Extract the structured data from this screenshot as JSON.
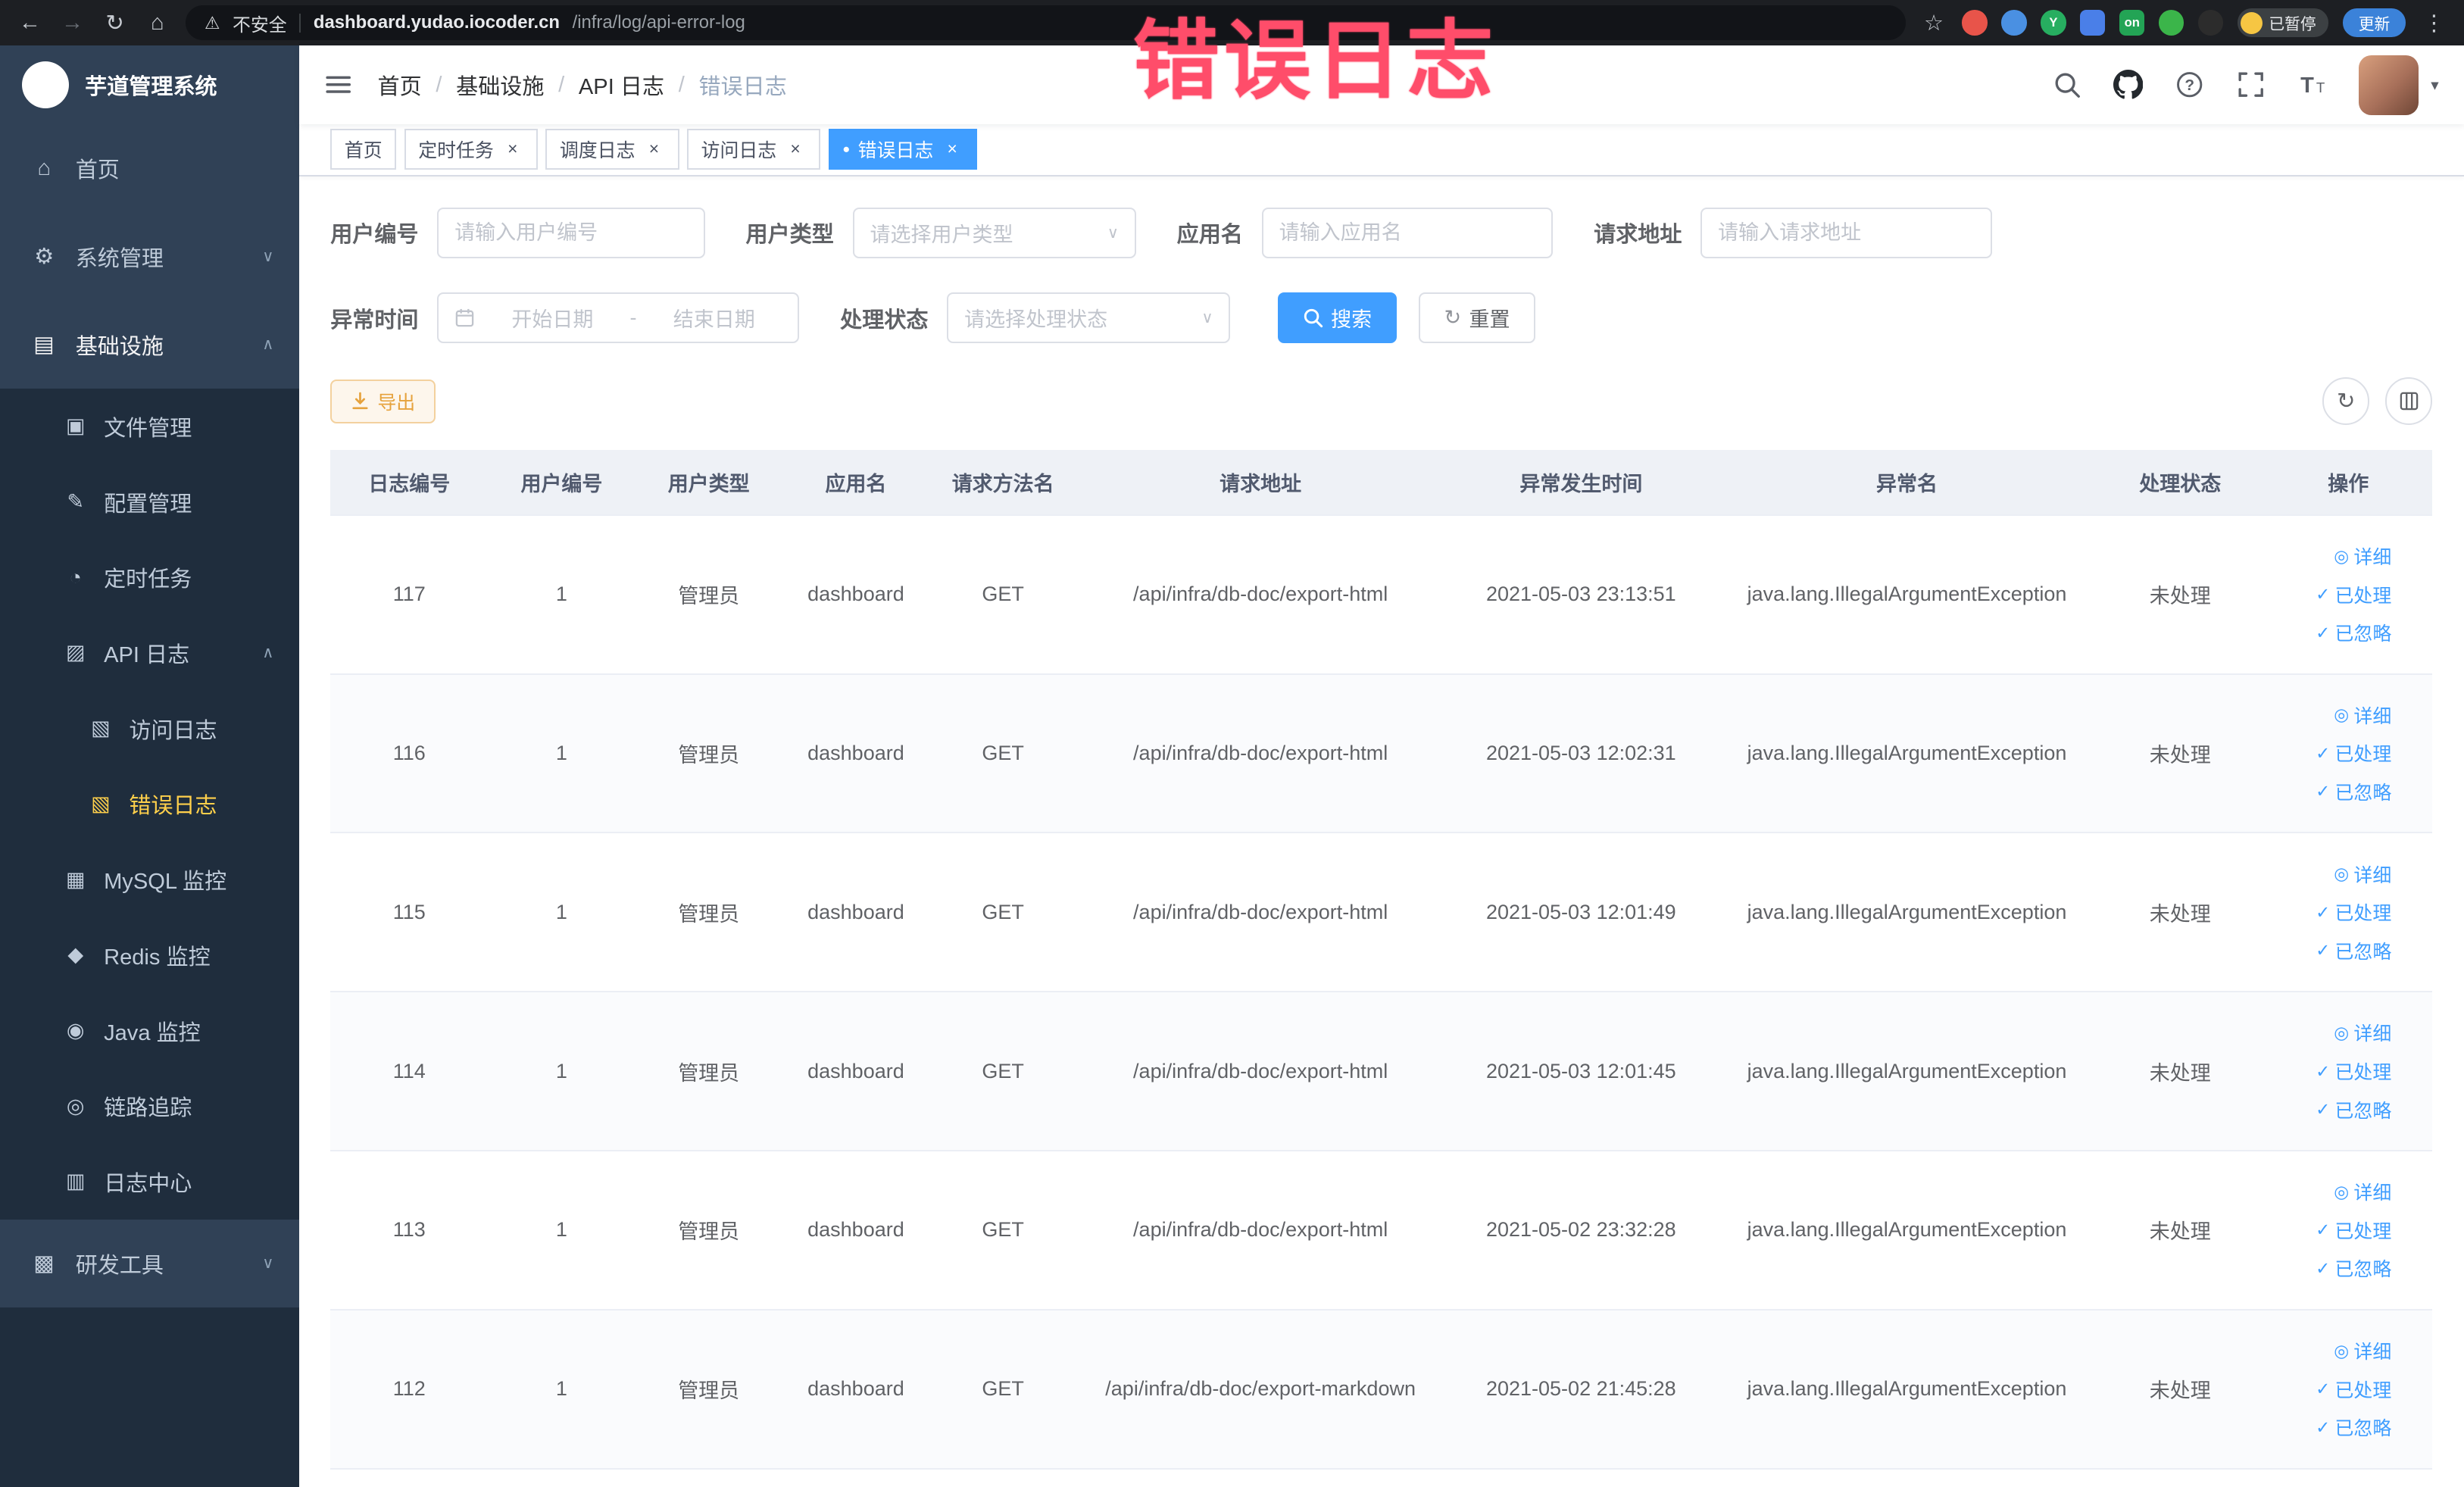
{
  "colors": {
    "primary": "#409EFF",
    "sidebar_bg": "#304156",
    "submenu_bg": "#1f2d3d",
    "active_menu_text": "#ffd04b",
    "warning": "#e6a23c",
    "annotation": "#ff4d6a"
  },
  "icons": {
    "back": "←",
    "forward": "→",
    "reload": "↻",
    "home": "⌂",
    "warning": "⚠",
    "star": "☆",
    "dots": "⋮",
    "close": "×",
    "active_dot": "●",
    "caret_down": "▾",
    "chevron_down": "∨",
    "chevron_up": "∧",
    "eye": "◎",
    "check": "✓",
    "refresh": "↻",
    "menu_home": "⌂",
    "menu_system": "⚙",
    "menu_infra": "▤",
    "menu_file": "▣",
    "menu_config": "✎",
    "menu_job": "◔",
    "menu_apilog": "▨",
    "menu_accesslog": "▧",
    "menu_errorlog": "▧",
    "menu_mysql": "▦",
    "menu_redis": "◆",
    "menu_java": "◉",
    "menu_trace": "◎",
    "menu_logcenter": "▥",
    "menu_devtools": "▩"
  },
  "browser": {
    "security_label": "不安全",
    "url_domain": "dashboard.yudao.iocoder.cn",
    "url_path": "/infra/log/api-error-log",
    "ext_y_label": "Y",
    "ext_on_label": "on",
    "paused_label": "已暂停",
    "update_label": "更新"
  },
  "annotation_text": "错误日志",
  "sidebar": {
    "logo_title": "芋道管理系统",
    "home": "首页",
    "system": "系统管理",
    "infra": "基础设施",
    "file": "文件管理",
    "config": "配置管理",
    "job": "定时任务",
    "apilog": "API 日志",
    "accesslog": "访问日志",
    "errorlog": "错误日志",
    "mysql": "MySQL 监控",
    "redis": "Redis 监控",
    "java": "Java 监控",
    "trace": "链路追踪",
    "logcenter": "日志中心",
    "devtools": "研发工具"
  },
  "breadcrumb": [
    "首页",
    "基础设施",
    "API 日志",
    "错误日志"
  ],
  "breadcrumb_separator": "/",
  "tabs": [
    {
      "label": "首页"
    },
    {
      "label": "定时任务"
    },
    {
      "label": "调度日志"
    },
    {
      "label": "访问日志"
    },
    {
      "label": "错误日志"
    }
  ],
  "filters": {
    "user_id_label": "用户编号",
    "user_id_placeholder": "请输入用户编号",
    "user_type_label": "用户类型",
    "user_type_placeholder": "请选择用户类型",
    "app_name_label": "应用名",
    "app_name_placeholder": "请输入应用名",
    "request_url_label": "请求地址",
    "request_url_placeholder": "请输入请求地址",
    "exception_time_label": "异常时间",
    "date_start_placeholder": "开始日期",
    "date_separator": "-",
    "date_end_placeholder": "结束日期",
    "process_status_label": "处理状态",
    "process_status_placeholder": "请选择处理状态",
    "search_button": "搜索",
    "reset_button": "重置"
  },
  "toolbar": {
    "export_button": "导出"
  },
  "table": {
    "columns": [
      "日志编号",
      "用户编号",
      "用户类型",
      "应用名",
      "请求方法名",
      "请求地址",
      "异常发生时间",
      "异常名",
      "处理状态",
      "操作"
    ],
    "rows": [
      [
        "117",
        "1",
        "管理员",
        "dashboard",
        "GET",
        "/api/infra/db-doc/export-html",
        "2021-05-03 23:13:51",
        "java.lang.IllegalArgumentException",
        "未处理"
      ],
      [
        "116",
        "1",
        "管理员",
        "dashboard",
        "GET",
        "/api/infra/db-doc/export-html",
        "2021-05-03 12:02:31",
        "java.lang.IllegalArgumentException",
        "未处理"
      ],
      [
        "115",
        "1",
        "管理员",
        "dashboard",
        "GET",
        "/api/infra/db-doc/export-html",
        "2021-05-03 12:01:49",
        "java.lang.IllegalArgumentException",
        "未处理"
      ],
      [
        "114",
        "1",
        "管理员",
        "dashboard",
        "GET",
        "/api/infra/db-doc/export-html",
        "2021-05-03 12:01:45",
        "java.lang.IllegalArgumentException",
        "未处理"
      ],
      [
        "113",
        "1",
        "管理员",
        "dashboard",
        "GET",
        "/api/infra/db-doc/export-html",
        "2021-05-02 23:32:28",
        "java.lang.IllegalArgumentException",
        "未处理"
      ],
      [
        "112",
        "1",
        "管理员",
        "dashboard",
        "GET",
        "/api/infra/db-doc/export-markdown",
        "2021-05-02 21:45:28",
        "java.lang.IllegalArgumentException",
        "未处理"
      ]
    ]
  },
  "row_actions": {
    "detail": "详细",
    "processed": "已处理",
    "ignored": "已忽略"
  }
}
